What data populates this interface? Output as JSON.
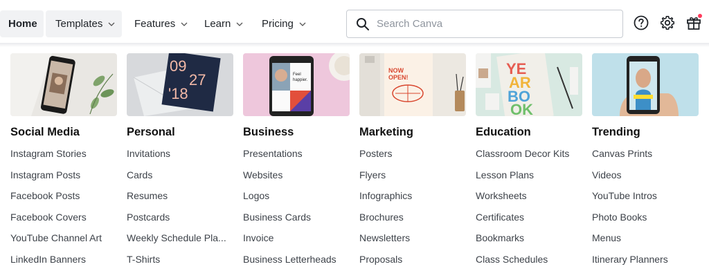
{
  "nav": {
    "home": "Home",
    "templates": "Templates",
    "features": "Features",
    "learn": "Learn",
    "pricing": "Pricing"
  },
  "search": {
    "placeholder": "Search Canva"
  },
  "colors": {
    "accent": "#ff3b5c",
    "text": "#1f2328",
    "muted": "#3d4249",
    "nav_active_bg": "#f1f2f4"
  },
  "icons": [
    "search-icon",
    "help-icon",
    "settings-gear-icon",
    "gift-icon",
    "chevron-down-icon"
  ],
  "categories": [
    {
      "title": "Social Media",
      "links": [
        "Instagram Stories",
        "Instagram Posts",
        "Facebook Posts",
        "Facebook Covers",
        "YouTube Channel Art",
        "LinkedIn Banners"
      ]
    },
    {
      "title": "Personal",
      "thumb_text": [
        "09",
        "27",
        "'18"
      ],
      "links": [
        "Invitations",
        "Cards",
        "Resumes",
        "Postcards",
        "Weekly Schedule Pla...",
        "T-Shirts"
      ]
    },
    {
      "title": "Business",
      "thumb_text": [
        "Feel",
        "happier."
      ],
      "links": [
        "Presentations",
        "Websites",
        "Logos",
        "Business Cards",
        "Invoice",
        "Business Letterheads"
      ]
    },
    {
      "title": "Marketing",
      "thumb_text": [
        "NOW",
        "OPEN!"
      ],
      "links": [
        "Posters",
        "Flyers",
        "Infographics",
        "Brochures",
        "Newsletters",
        "Proposals"
      ]
    },
    {
      "title": "Education",
      "thumb_text": [
        "YE",
        "AR",
        "BO",
        "OK"
      ],
      "links": [
        "Classroom Decor Kits",
        "Lesson Plans",
        "Worksheets",
        "Certificates",
        "Bookmarks",
        "Class Schedules"
      ]
    },
    {
      "title": "Trending",
      "links": [
        "Canvas Prints",
        "Videos",
        "YouTube Intros",
        "Photo Books",
        "Menus",
        "Itinerary Planners"
      ]
    }
  ]
}
